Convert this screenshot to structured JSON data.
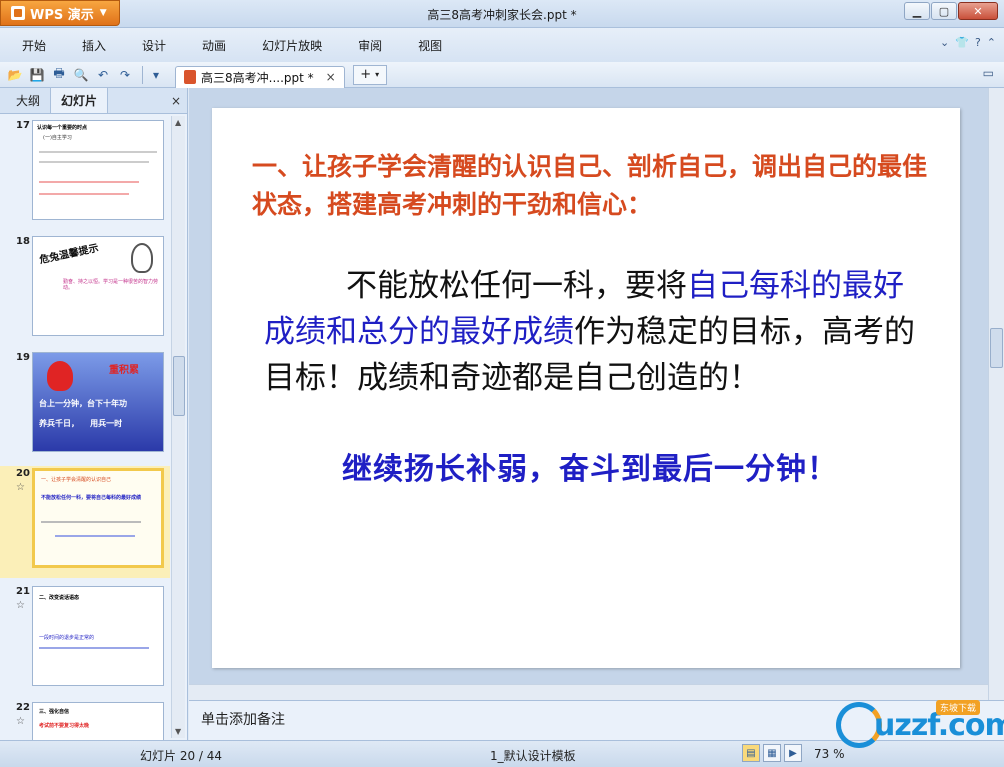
{
  "titlebar": {
    "app_button": "WPS 演示",
    "title": "高三8高考冲刺家长会.ppt *"
  },
  "menu": {
    "items": [
      "开始",
      "插入",
      "设计",
      "动画",
      "幻灯片放映",
      "审阅",
      "视图"
    ]
  },
  "tabs": {
    "doc_tab": "高三8高考冲....ppt *",
    "close": "×",
    "new_tab": "+"
  },
  "sidepanel": {
    "tab_outline": "大纲",
    "tab_slides": "幻灯片",
    "close": "×",
    "thumbs": [
      {
        "num": "17",
        "star": "",
        "line1": "认识每一个重要的时点",
        "line2": "(一)自主学习"
      },
      {
        "num": "18",
        "star": "",
        "line1": "危兔温馨提示",
        "line2": "勤奋、持之以恒。学习是一种很苦的智力劳动。"
      },
      {
        "num": "19",
        "star": "",
        "line1": "重积累",
        "line2": "台上一分钟，台下十年功",
        "line3": "养兵千日，    用兵一时"
      },
      {
        "num": "20",
        "star": "☆",
        "line1": "一、让孩子学会清醒的认识自己",
        "line2": "不能放松任何一科，要将自己每科的最好成绩"
      },
      {
        "num": "21",
        "star": "☆",
        "line1": "二、改变说话语态",
        "line2": "一段时间的退步是正常的"
      },
      {
        "num": "22",
        "star": "☆",
        "line1": "三、强化自信",
        "line2": "考试前不要复习得太晚"
      }
    ]
  },
  "slide": {
    "heading": "一、让孩子学会清醒的认识自己、剖析自己，调出自己的最佳状态，搭建高考冲刺的干劲和信心：",
    "body_part1": "不能放松任何一科，要将",
    "body_blue": "自己每科的最好成绩和总分的最好成绩",
    "body_part2": "作为稳定的目标，高考的目标！成绩和奇迹都是自己创造的！",
    "note": "继续扬长补弱，奋斗到最后一分钟！"
  },
  "notes": {
    "placeholder": "单击添加备注"
  },
  "status": {
    "slide_counter": "幻灯片 20 / 44",
    "template": "1_默认设计模板",
    "zoom": "73 %"
  },
  "watermark": {
    "brand": "uzzf.com",
    "tag": "东坡下载"
  },
  "colors": {
    "heading": "#d64a1f",
    "body": "#111111",
    "highlight": "#1f1fc4",
    "wps_orange": "#e0721a"
  }
}
